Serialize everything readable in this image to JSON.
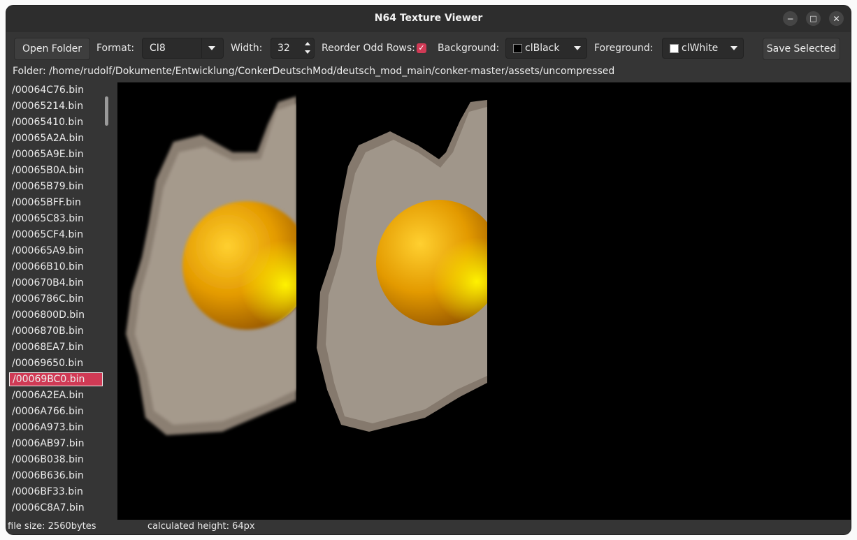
{
  "window": {
    "title": "N64 Texture Viewer"
  },
  "window_controls": {
    "minimize": "−",
    "maximize": "□",
    "close": "✕"
  },
  "toolbar": {
    "open_folder": "Open Folder",
    "format_label": "Format:",
    "format_value": "CI8",
    "width_label": "Width:",
    "width_value": "32",
    "reorder_label": "Reorder Odd Rows:",
    "reorder_checked": true,
    "background_label": "Background:",
    "background_value": "clBlack",
    "background_color": "#000000",
    "foreground_label": "Foreground:",
    "foreground_value": "clWhite",
    "foreground_color": "#ffffff",
    "save_selected": "Save Selected"
  },
  "folder_path": "Folder: /home/rudolf/Dokumente/Entwicklung/ConkerDeutschMod/deutsch_mod_main/conker-master/assets/uncompressed",
  "files": [
    "/00064C76.bin",
    "/00065214.bin",
    "/00065410.bin",
    "/00065A2A.bin",
    "/00065A9E.bin",
    "/00065B0A.bin",
    "/00065B79.bin",
    "/00065BFF.bin",
    "/00065C83.bin",
    "/00065CF4.bin",
    "/000665A9.bin",
    "/00066B10.bin",
    "/000670B4.bin",
    "/0006786C.bin",
    "/0006800D.bin",
    "/0006870B.bin",
    "/00068EA7.bin",
    "/00069650.bin",
    "/00069BC0.bin",
    "/0006A2EA.bin",
    "/0006A766.bin",
    "/0006A973.bin",
    "/0006AB97.bin",
    "/0006B038.bin",
    "/0006B636.bin",
    "/0006BF33.bin",
    "/0006C8A7.bin"
  ],
  "selected_index": 18,
  "status": {
    "file_size": "file size: 2560bytes",
    "calculated_height": "calculated height: 64px"
  },
  "colors": {
    "accent": "#d03a55",
    "window_bg": "#353535",
    "viewer_bg": "#000000"
  }
}
